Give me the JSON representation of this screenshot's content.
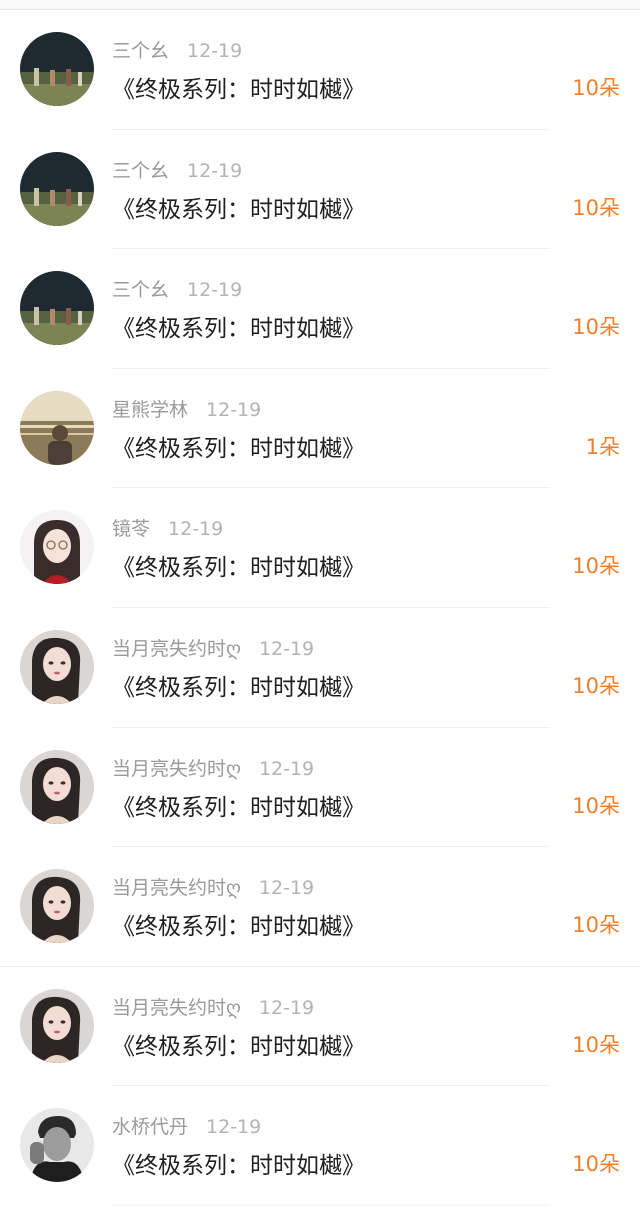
{
  "records": [
    {
      "user": "三个幺",
      "date": "12-19",
      "title": "《终极系列：时时如樾》",
      "amount": "10朵",
      "avatar": "night-crowd-icon"
    },
    {
      "user": "三个幺",
      "date": "12-19",
      "title": "《终极系列：时时如樾》",
      "amount": "10朵",
      "avatar": "night-crowd-icon"
    },
    {
      "user": "三个幺",
      "date": "12-19",
      "title": "《终极系列：时时如樾》",
      "amount": "10朵",
      "avatar": "night-crowd-icon"
    },
    {
      "user": "星熊学林",
      "date": "12-19",
      "title": "《终极系列：时时如樾》",
      "amount": "1朵",
      "avatar": "sea-sunset-icon"
    },
    {
      "user": "镜苓",
      "date": "12-19",
      "title": "《终极系列：时时如樾》",
      "amount": "10朵",
      "avatar": "girl-glasses-icon"
    },
    {
      "user": "当月亮失约时ღ",
      "date": "12-19",
      "title": "《终极系列：时时如樾》",
      "amount": "10朵",
      "avatar": "girl-portrait-icon"
    },
    {
      "user": "当月亮失约时ღ",
      "date": "12-19",
      "title": "《终极系列：时时如樾》",
      "amount": "10朵",
      "avatar": "girl-portrait-icon"
    },
    {
      "user": "当月亮失约时ღ",
      "date": "12-19",
      "title": "《终极系列：时时如樾》",
      "amount": "10朵",
      "avatar": "girl-portrait-icon"
    },
    {
      "user": "当月亮失约时ღ",
      "date": "12-19",
      "title": "《终极系列：时时如樾》",
      "amount": "10朵",
      "avatar": "girl-portrait-icon"
    },
    {
      "user": "水桥代丹",
      "date": "12-19",
      "title": "《终极系列：时时如樾》",
      "amount": "10朵",
      "avatar": "man-bw-icon"
    }
  ],
  "colors": {
    "amount": "#f07f2c",
    "meta": "#9a9a9a",
    "title": "#1f1f1f"
  }
}
